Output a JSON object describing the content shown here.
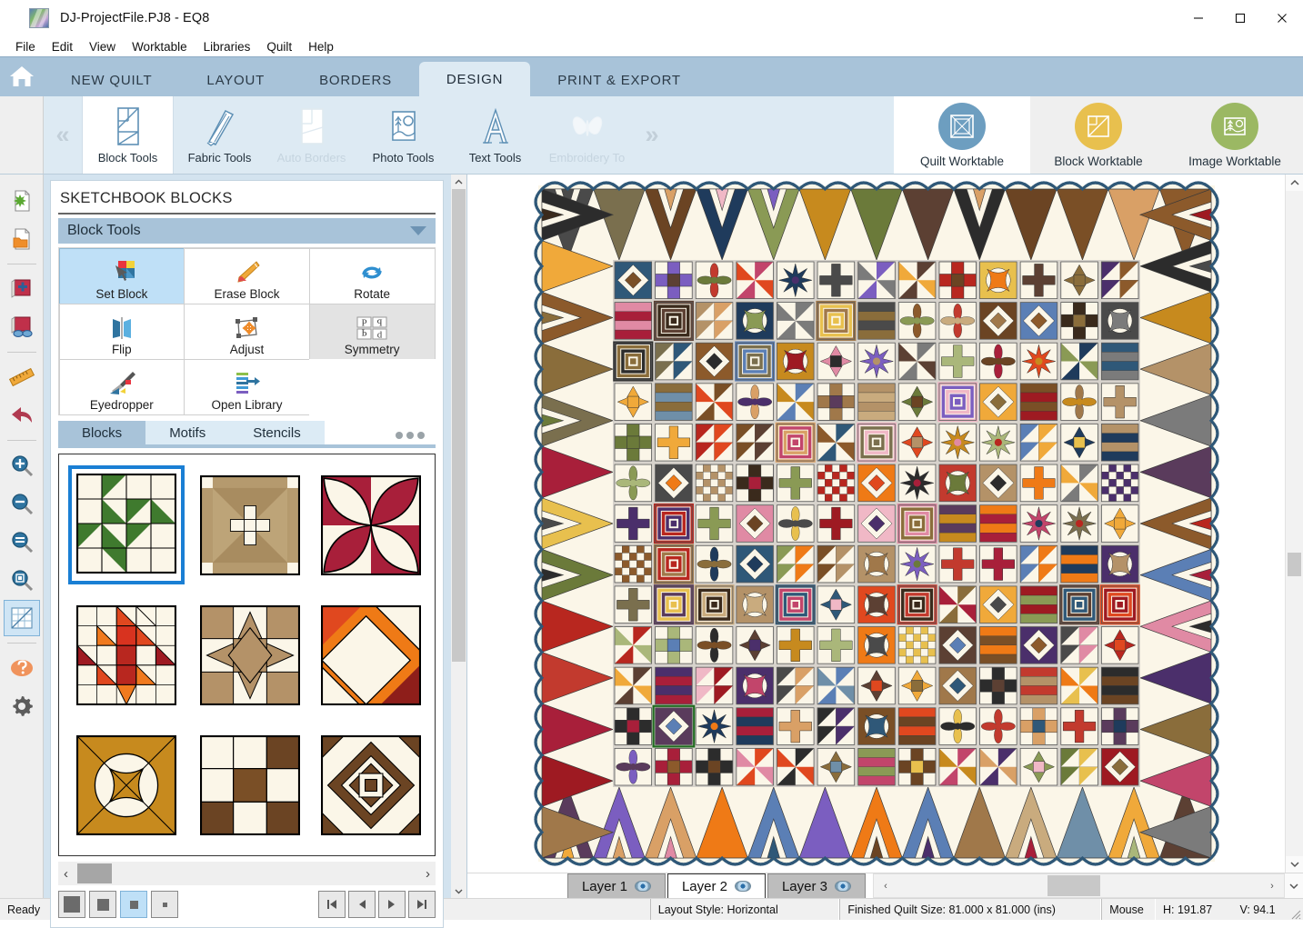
{
  "window": {
    "title": "DJ-ProjectFile.PJ8 - EQ8",
    "app_icon": "quilt-logo-icon",
    "controls": {
      "minimize": "minimize-icon",
      "maximize": "maximize-icon",
      "close": "close-icon"
    }
  },
  "menubar": {
    "items": [
      "File",
      "Edit",
      "View",
      "Worktable",
      "Libraries",
      "Quilt",
      "Help"
    ]
  },
  "ribbon": {
    "home_icon": "home-icon",
    "tabs": [
      {
        "label": "NEW QUILT",
        "active": false
      },
      {
        "label": "LAYOUT",
        "active": false
      },
      {
        "label": "BORDERS",
        "active": false
      },
      {
        "label": "DESIGN",
        "active": true
      },
      {
        "label": "PRINT & EXPORT",
        "active": false
      }
    ],
    "scroll_left": "«",
    "scroll_right": "»",
    "items": [
      {
        "label": "Block Tools",
        "icon": "block-tools-icon",
        "selected": true,
        "disabled": false
      },
      {
        "label": "Fabric Tools",
        "icon": "fabric-brush-icon",
        "selected": false,
        "disabled": false
      },
      {
        "label": "Auto Borders",
        "icon": "auto-borders-icon",
        "selected": false,
        "disabled": true
      },
      {
        "label": "Photo Tools",
        "icon": "photo-icon",
        "selected": false,
        "disabled": false
      },
      {
        "label": "Text Tools",
        "icon": "letter-a-icon",
        "selected": false,
        "disabled": false
      },
      {
        "label": "Embroidery To",
        "icon": "butterfly-icon",
        "selected": false,
        "disabled": true
      }
    ],
    "worktables": [
      {
        "label": "Quilt Worktable",
        "icon": "quilt-worktable-icon",
        "color": "#6d9ec0",
        "selected": true
      },
      {
        "label": "Block Worktable",
        "icon": "block-worktable-icon",
        "color": "#e8c04e",
        "selected": false
      },
      {
        "label": "Image Worktable",
        "icon": "image-worktable-icon",
        "color": "#9bb863",
        "selected": false
      }
    ]
  },
  "vertical_toolbar": {
    "groups": [
      [
        {
          "icon": "new-project-icon"
        },
        {
          "icon": "open-project-icon"
        }
      ],
      [
        {
          "icon": "add-to-sketchbook-icon"
        },
        {
          "icon": "view-sketchbook-icon"
        }
      ],
      [
        {
          "icon": "ruler-icon"
        },
        {
          "icon": "undo-arrow-icon"
        }
      ],
      [
        {
          "icon": "zoom-in-icon"
        },
        {
          "icon": "zoom-out-icon"
        },
        {
          "icon": "zoom-fit-icon"
        },
        {
          "icon": "zoom-rect-icon"
        },
        {
          "icon": "grid-toggle-icon",
          "selected": true
        }
      ],
      [
        {
          "icon": "help-icon"
        },
        {
          "icon": "settings-gear-icon"
        }
      ]
    ]
  },
  "sidebar": {
    "title": "SKETCHBOOK BLOCKS",
    "group": {
      "label": "Block Tools",
      "collapse_icon": "chevron-down-icon"
    },
    "tools": [
      {
        "label": "Set Block",
        "icon": "set-block-icon",
        "state": "active"
      },
      {
        "label": "Erase Block",
        "icon": "eraser-icon",
        "state": "normal"
      },
      {
        "label": "Rotate",
        "icon": "rotate-icon",
        "state": "normal"
      },
      {
        "label": "Flip",
        "icon": "flip-icon",
        "state": "normal"
      },
      {
        "label": "Adjust",
        "icon": "adjust-icon",
        "state": "normal"
      },
      {
        "label": "Symmetry",
        "icon": "symmetry-icon",
        "state": "disabled"
      },
      {
        "label": "Eyedropper",
        "icon": "eyedropper-icon",
        "state": "normal"
      },
      {
        "label": "Open Library",
        "icon": "open-library-icon",
        "state": "normal"
      }
    ],
    "library_tabs": [
      {
        "label": "Blocks",
        "active": true
      },
      {
        "label": "Motifs",
        "active": false
      },
      {
        "label": "Stencils",
        "active": false
      }
    ],
    "overflow_icon": "more-dots-icon",
    "blocks": [
      {
        "name": "pinwheel-green-block",
        "selected": true
      },
      {
        "name": "tan-plaid-star-block",
        "selected": false
      },
      {
        "name": "red-petal-block",
        "selected": false
      },
      {
        "name": "red-orange-diamond-block",
        "selected": false
      },
      {
        "name": "tan-nine-patch-block",
        "selected": false
      },
      {
        "name": "orange-diagonal-block",
        "selected": false
      },
      {
        "name": "gold-circle-block",
        "selected": false
      },
      {
        "name": "brown-nine-patch-block",
        "selected": false
      },
      {
        "name": "brown-diamond-ring-block",
        "selected": false
      }
    ],
    "size_buttons": [
      {
        "name": "thumbnail-size-large",
        "active": false
      },
      {
        "name": "thumbnail-size-medium",
        "active": false
      },
      {
        "name": "thumbnail-size-small",
        "active": true
      },
      {
        "name": "thumbnail-size-tiny",
        "active": false
      }
    ],
    "nav_buttons": [
      {
        "name": "first-page-button",
        "glyph": "first"
      },
      {
        "name": "prev-page-button",
        "glyph": "prev"
      },
      {
        "name": "next-page-button",
        "glyph": "next"
      },
      {
        "name": "last-page-button",
        "glyph": "last"
      }
    ],
    "hscroll": {
      "left_arrow": "‹",
      "right_arrow": "›"
    }
  },
  "canvas": {
    "layer_tabs": [
      {
        "label": "Layer 1",
        "eye": "eye-icon",
        "active": false
      },
      {
        "label": "Layer 2",
        "eye": "eye-icon",
        "active": true
      },
      {
        "label": "Layer 3",
        "eye": "eye-icon",
        "active": false
      }
    ],
    "quilt": {
      "name": "dear-jane-sampler-quilt",
      "grid_rows": 13,
      "grid_cols": 13,
      "border_triangles_per_side": 13,
      "edge_color": "#2f5878",
      "background": "#f5efdf"
    },
    "scroll": {
      "up": "⌃",
      "down": "⌄",
      "left": "‹",
      "right": "›"
    }
  },
  "statusbar": {
    "ready": "Ready",
    "layout_style": "Layout Style: Horizontal",
    "quilt_size": "Finished Quilt Size: 81.000 x 81.000 (ins)",
    "mouse_label": "Mouse",
    "mouse_h": "H:  191.87",
    "mouse_v": "V:  94.1"
  }
}
